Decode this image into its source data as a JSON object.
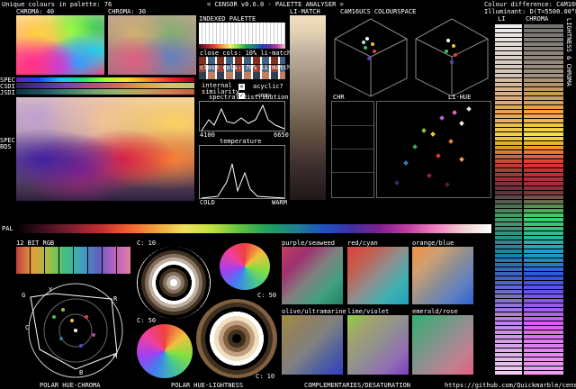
{
  "header": {
    "unique_colours": "Unique colours in palette: 76",
    "title": "= CENSOR v0.6.0 - PALETTE ANALYSER =",
    "colour_difference": "Colour difference: CAM16UCS",
    "illuminant": "Illuminant: D(T=5500.00°K)"
  },
  "panels": {
    "chroma40": "CHROMA: 40",
    "chroma30": "CHROMA: 30",
    "indexed_palette": "INDEXED PALETTE",
    "li_match": "LI-MATCH",
    "cam16ucs_space": "CAM16UCS COLOURSPACE",
    "spec_labels": [
      "SPEC",
      "CSDI",
      "JSDI"
    ],
    "spec_labels2": [
      "SPEC",
      "BDS"
    ],
    "close_cols_10": "close cols: 10% li-match",
    "close_cols_70": "close cols: 70% li-match",
    "internal_similarity": "internal similarity",
    "acyclic": "acyclic?",
    "na": "<na>",
    "spectral_distribution": "spectral distribution",
    "wl_start": "4100",
    "wl_end": "6650",
    "temperature": "temperature",
    "cold": "COLD",
    "warm": "WARM",
    "chr": "CHR",
    "li_hue": "LI-HUE",
    "li": "LI",
    "chroma": "CHROMA",
    "lightness_chroma": "LIGHTNESS & CHROMA",
    "pal": "PAL",
    "bit12": "12 BIT RGB",
    "c10a": "C: 10",
    "c50a": "C: 50",
    "c50b": "C: 50",
    "c10b": "C: 10",
    "polar_hue_chroma": "POLAR HUE-CHROMA",
    "polar_hue_lightness": "POLAR HUE-LIGHTNESS",
    "complementaries": "COMPLEMENTARIES/DESATURATION",
    "url": "https://github.com/Quickmarble/censor",
    "comp_titles": [
      "purple/seaweed",
      "red/cyan",
      "orange/blue",
      "olive/ultramarine",
      "lime/violet",
      "emerald/rose"
    ],
    "hue_letters": [
      "G",
      "Y",
      "R",
      "C",
      "M",
      "B"
    ]
  },
  "colors": {
    "accent_frame": "#bbbbbb",
    "background": "#000000"
  }
}
